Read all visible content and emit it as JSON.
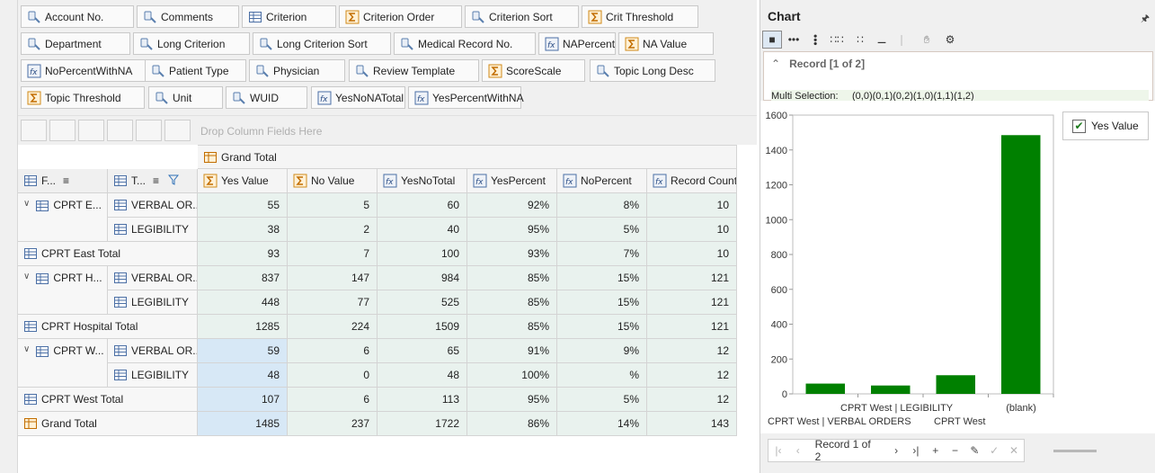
{
  "field_list": [
    {
      "label": "Account No.",
      "icon": "dimension-icon"
    },
    {
      "label": "Comments",
      "icon": "dimension-icon"
    },
    {
      "label": "Criterion",
      "icon": "grid-icon"
    },
    {
      "label": "Criterion Order",
      "icon": "sum-icon"
    },
    {
      "label": "Criterion Sort",
      "icon": "dimension-icon"
    },
    {
      "label": "Crit Threshold",
      "icon": "sum-icon"
    },
    {
      "label": "Department",
      "icon": "dimension-icon"
    },
    {
      "label": "Long Criterion",
      "icon": "dimension-icon"
    },
    {
      "label": "Long Criterion Sort",
      "icon": "dimension-icon"
    },
    {
      "label": "Medical Record No.",
      "icon": "dimension-icon"
    },
    {
      "label": "NAPercent",
      "icon": "fx-icon"
    },
    {
      "label": "NA Value",
      "icon": "sum-icon"
    },
    {
      "label": "NoPercentWithNA",
      "icon": "fx-icon"
    },
    {
      "label": "Patient Type",
      "icon": "dimension-icon"
    },
    {
      "label": "Physician",
      "icon": "dimension-icon"
    },
    {
      "label": "Review Template",
      "icon": "dimension-icon"
    },
    {
      "label": "ScoreScale",
      "icon": "sum-icon"
    },
    {
      "label": "Topic Long Desc",
      "icon": "dimension-icon"
    },
    {
      "label": "Topic Threshold",
      "icon": "sum-icon"
    },
    {
      "label": "Unit",
      "icon": "dimension-icon"
    },
    {
      "label": "WUID",
      "icon": "dimension-icon"
    },
    {
      "label": "YesNoNATotal",
      "icon": "fx-icon"
    },
    {
      "label": "YesPercentWithNA",
      "icon": "fx-icon"
    }
  ],
  "drop_column_placeholder": "Drop Column Fields Here",
  "pivot": {
    "grand_total_header": "Grand Total",
    "row_field_1": "F...",
    "row_field_2": "T...",
    "columns": [
      {
        "label": "Yes Value",
        "icon": "sum-icon"
      },
      {
        "label": "No Value",
        "icon": "sum-icon"
      },
      {
        "label": "YesNoTotal",
        "icon": "fx-icon"
      },
      {
        "label": "YesPercent",
        "icon": "fx-icon"
      },
      {
        "label": "NoPercent",
        "icon": "fx-icon"
      },
      {
        "label": "Record Count",
        "icon": "fx-icon"
      }
    ],
    "rows": [
      {
        "group": "CPRT E...",
        "sub": "VERBAL OR...",
        "values": [
          "55",
          "5",
          "60",
          "92%",
          "8%",
          "10"
        ],
        "expandable": true
      },
      {
        "group": "",
        "sub": "LEGIBILITY",
        "values": [
          "38",
          "2",
          "40",
          "95%",
          "5%",
          "10"
        ]
      },
      {
        "total": "CPRT East Total",
        "values": [
          "93",
          "7",
          "100",
          "93%",
          "7%",
          "10"
        ]
      },
      {
        "group": "CPRT H...",
        "sub": "VERBAL OR...",
        "values": [
          "837",
          "147",
          "984",
          "85%",
          "15%",
          "121"
        ],
        "expandable": true
      },
      {
        "group": "",
        "sub": "LEGIBILITY",
        "values": [
          "448",
          "77",
          "525",
          "85%",
          "15%",
          "121"
        ]
      },
      {
        "total": "CPRT Hospital Total",
        "values": [
          "1285",
          "224",
          "1509",
          "85%",
          "15%",
          "121"
        ]
      },
      {
        "group": "CPRT W...",
        "sub": "VERBAL OR...",
        "values": [
          "59",
          "6",
          "65",
          "91%",
          "9%",
          "12"
        ],
        "expandable": true
      },
      {
        "group": "",
        "sub": "LEGIBILITY",
        "values": [
          "48",
          "0",
          "48",
          "100%",
          "%",
          "12"
        ]
      },
      {
        "total": "CPRT West Total",
        "values": [
          "107",
          "6",
          "113",
          "95%",
          "5%",
          "12"
        ]
      },
      {
        "total": "Grand Total",
        "values": [
          "1485",
          "237",
          "1722",
          "86%",
          "14%",
          "143"
        ],
        "grand": true
      }
    ]
  },
  "chart_panel": {
    "title": "Chart",
    "record_header": "Record [1 of 2]",
    "multi_selection_label": "Multi Selection:",
    "multi_selection_value": "(0,0)(0,1)(0,2)(1,0)(1,1)(1,2)",
    "legend_label": "Yes Value",
    "series_color": "#008000"
  },
  "chart_data": {
    "type": "bar",
    "categories": [
      "CPRT West | VERBAL ORDERS",
      "CPRT West | LEGIBILITY",
      "CPRT West",
      "(blank)"
    ],
    "series": [
      {
        "name": "Yes Value",
        "values": [
          59,
          48,
          107,
          1485
        ]
      }
    ],
    "ylim": [
      0,
      1600
    ],
    "yticks": [
      0,
      200,
      400,
      600,
      800,
      1000,
      1200,
      1400,
      1600
    ],
    "legend": "top-right",
    "grid": false
  },
  "navigator": {
    "record_text": "Record 1 of 2"
  }
}
